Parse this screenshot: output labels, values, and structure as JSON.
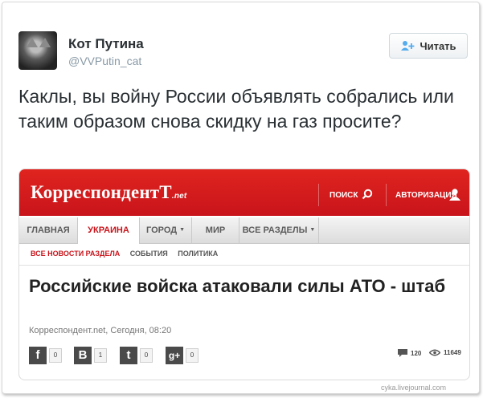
{
  "tweet": {
    "display_name": "Кот Путина",
    "handle": "@VVPutin_cat",
    "follow_label": "Читать",
    "text": "Каклы, вы войну России объявлять собрались или таким образом снова скидку на газ просите?"
  },
  "news": {
    "logo": "КорреспондентТ",
    "logo_suffix": ".net",
    "search_label": "ПОИСК",
    "auth_label": "АВТОРИЗАЦИЯ",
    "nav": [
      {
        "label": "ГЛАВНАЯ"
      },
      {
        "label": "УКРАИНА"
      },
      {
        "label": "ГОРОД"
      },
      {
        "label": "МИР"
      },
      {
        "label": "ВСЕ РАЗДЕЛЫ"
      }
    ],
    "sub_nav": [
      "ВСЕ НОВОСТИ РАЗДЕЛА",
      "СОБЫТИЯ",
      "ПОЛИТИКА"
    ],
    "headline": "Российские войска атаковали силы АТО - штаб",
    "byline": "Корреспондент.net, Сегодня, 08:20",
    "share": [
      {
        "icon": "facebook-icon",
        "glyph": "f",
        "count": "0"
      },
      {
        "icon": "vkontakte-icon",
        "glyph": "В",
        "count": "1"
      },
      {
        "icon": "twitter-icon",
        "glyph": "t",
        "count": "0"
      },
      {
        "icon": "googleplus-icon",
        "glyph": "g+",
        "count": "0"
      }
    ],
    "comments": "120",
    "views": "11649"
  },
  "watermark": "cyka.livejournal.com",
  "colors": {
    "brand_red": "#c8141b",
    "text": "#292f33",
    "muted": "#8899a6"
  }
}
